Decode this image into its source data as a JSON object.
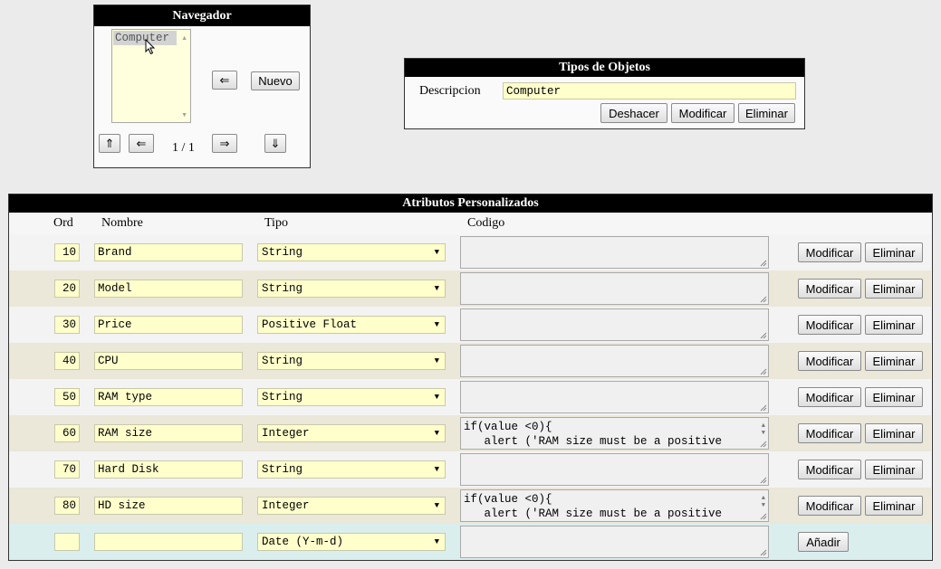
{
  "navigator": {
    "title": "Navegador",
    "items": [
      "Computer"
    ],
    "selected": "Computer",
    "back_button": "⇐",
    "new_button": "Nuevo",
    "first_button": "⇑",
    "prev_button": "⇐",
    "position": "1 / 1",
    "next_button": "⇒",
    "last_button": "⇓"
  },
  "object_types": {
    "title": "Tipos de Objetos",
    "description_label": "Descripcion",
    "description_value": "Computer",
    "undo_button": "Deshacer",
    "modify_button": "Modificar",
    "delete_button": "Eliminar"
  },
  "attributes": {
    "title": "Atributos Personalizados",
    "columns": {
      "ord": "Ord",
      "name": "Nombre",
      "type": "Tipo",
      "code": "Codigo"
    },
    "modify_label": "Modificar",
    "delete_label": "Eliminar",
    "add_label": "Añadir",
    "rows": [
      {
        "ord": "10",
        "name": "Brand",
        "type": "String",
        "code": ""
      },
      {
        "ord": "20",
        "name": "Model",
        "type": "String",
        "code": ""
      },
      {
        "ord": "30",
        "name": "Price",
        "type": "Positive Float",
        "code": ""
      },
      {
        "ord": "40",
        "name": "CPU",
        "type": "String",
        "code": ""
      },
      {
        "ord": "50",
        "name": "RAM type",
        "type": "String",
        "code": ""
      },
      {
        "ord": "60",
        "name": "RAM size",
        "type": "Integer",
        "code": "if(value <0){\n   alert ('RAM size must be a positive"
      },
      {
        "ord": "70",
        "name": "Hard Disk",
        "type": "String",
        "code": ""
      },
      {
        "ord": "80",
        "name": "HD size",
        "type": "Integer",
        "code": "if(value <0){\n   alert ('RAM size must be a positive"
      }
    ],
    "new_row": {
      "ord": "",
      "name": "",
      "type": "Date (Y-m-d)",
      "code": ""
    }
  },
  "colors": {
    "header_bg": "#000000",
    "input_bg": "#ffffcc",
    "row_even": "#f3f3f3",
    "row_odd": "#ebe7d9",
    "new_row_bg": "#daeeee"
  },
  "icons": [
    "mouse-cursor-icon",
    "resize-grip-icon",
    "dropdown-arrow-icon",
    "scroll-up-icon",
    "scroll-down-icon"
  ]
}
